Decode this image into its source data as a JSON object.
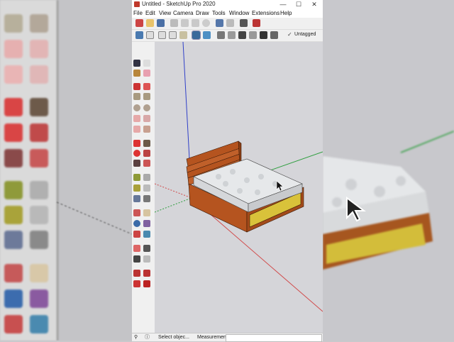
{
  "window": {
    "title": "Untitled - SketchUp Pro 2020",
    "minimize": "—",
    "maximize": "☐",
    "close": "✕"
  },
  "menu": [
    "File",
    "Edit",
    "View",
    "Camera",
    "Draw",
    "Tools",
    "Window",
    "Extensions",
    "Help"
  ],
  "toolbar": {
    "tag_check": "✓",
    "tag_label": "Untagged"
  },
  "status": {
    "hint": "Select objec...",
    "measurements_label": "Measurements"
  },
  "colors": {
    "axis_red": "#d14a4a",
    "axis_green": "#2e9e3e",
    "axis_blue": "#3040c8",
    "wood": "#b5541f",
    "drawer": "#d9c23a",
    "mattress": "#e6e8ea"
  }
}
